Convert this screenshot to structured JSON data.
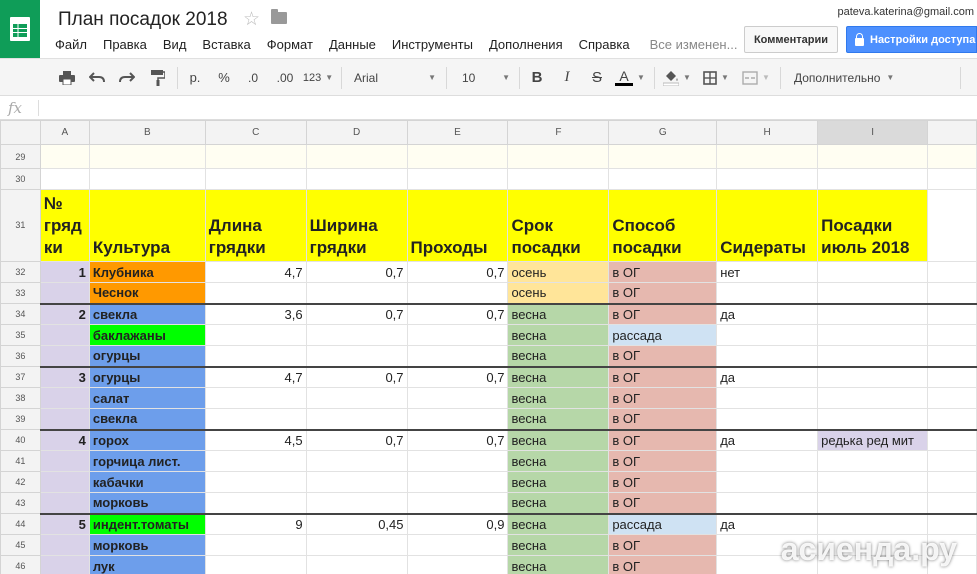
{
  "app": {
    "title": "План посадок 2018",
    "user_email": "pateva.katerina@gmail.com",
    "comments_label": "Комментарии",
    "share_label": "Настройки доступа",
    "save_status": "Все изменен..."
  },
  "menu": [
    "Файл",
    "Правка",
    "Вид",
    "Вставка",
    "Формат",
    "Данные",
    "Инструменты",
    "Дополнения",
    "Справка"
  ],
  "toolbar": {
    "currency": "р.",
    "percent": "%",
    "dec_less": ".0",
    "dec_more": ".00",
    "format_more": "123",
    "font": "Arial",
    "font_size": "10",
    "bold": "B",
    "italic": "I",
    "strike": "S",
    "text_color": "A",
    "more": "Дополнительно"
  },
  "formula_bar": {
    "fx": "fx",
    "value": ""
  },
  "columns": [
    "A",
    "B",
    "C",
    "D",
    "E",
    "F",
    "G",
    "H",
    "I"
  ],
  "header": {
    "row": "31",
    "A": "№ гряд ки",
    "B": "Культура",
    "C": "Длина грядки",
    "D": "Ширина грядки",
    "E": "Проходы",
    "F": "Срок посадки",
    "G": "Способ посадки",
    "H": "Сидераты",
    "I": "Посадки июль 2018"
  },
  "rows": [
    {
      "n": "29",
      "A": "",
      "B": "",
      "C": "",
      "D": "",
      "E": "",
      "F": "",
      "G": "",
      "H": "",
      "I": ""
    },
    {
      "n": "30",
      "A": "",
      "B": "",
      "C": "",
      "D": "",
      "E": "",
      "F": "",
      "G": "",
      "H": "",
      "I": ""
    },
    {
      "n": "32",
      "A": "1",
      "B": "Клубника",
      "C": "4,7",
      "D": "0,7",
      "E": "0,7",
      "F": "осень",
      "G": "в ОГ",
      "H": "нет",
      "I": ""
    },
    {
      "n": "33",
      "A": "",
      "B": "Чеснок",
      "C": "",
      "D": "",
      "E": "",
      "F": "осень",
      "G": "в ОГ",
      "H": "",
      "I": ""
    },
    {
      "n": "34",
      "A": "2",
      "B": "свекла",
      "C": "3,6",
      "D": "0,7",
      "E": "0,7",
      "F": "весна",
      "G": "в ОГ",
      "H": "да",
      "I": ""
    },
    {
      "n": "35",
      "A": "",
      "B": "баклажаны",
      "C": "",
      "D": "",
      "E": "",
      "F": "весна",
      "G": "рассада",
      "H": "",
      "I": ""
    },
    {
      "n": "36",
      "A": "",
      "B": "огурцы",
      "C": "",
      "D": "",
      "E": "",
      "F": "весна",
      "G": "в ОГ",
      "H": "",
      "I": ""
    },
    {
      "n": "37",
      "A": "3",
      "B": "огурцы",
      "C": "4,7",
      "D": "0,7",
      "E": "0,7",
      "F": "весна",
      "G": "в ОГ",
      "H": "да",
      "I": ""
    },
    {
      "n": "38",
      "A": "",
      "B": "салат",
      "C": "",
      "D": "",
      "E": "",
      "F": "весна",
      "G": "в ОГ",
      "H": "",
      "I": ""
    },
    {
      "n": "39",
      "A": "",
      "B": "свекла",
      "C": "",
      "D": "",
      "E": "",
      "F": "весна",
      "G": "в ОГ",
      "H": "",
      "I": ""
    },
    {
      "n": "40",
      "A": "4",
      "B": "горох",
      "C": "4,5",
      "D": "0,7",
      "E": "0,7",
      "F": "весна",
      "G": "в ОГ",
      "H": "да",
      "I": "редька ред мит"
    },
    {
      "n": "41",
      "A": "",
      "B": "горчица лист.",
      "C": "",
      "D": "",
      "E": "",
      "F": "весна",
      "G": "в ОГ",
      "H": "",
      "I": ""
    },
    {
      "n": "42",
      "A": "",
      "B": "кабачки",
      "C": "",
      "D": "",
      "E": "",
      "F": "весна",
      "G": "в ОГ",
      "H": "",
      "I": ""
    },
    {
      "n": "43",
      "A": "",
      "B": "морковь",
      "C": "",
      "D": "",
      "E": "",
      "F": "весна",
      "G": "в ОГ",
      "H": "",
      "I": ""
    },
    {
      "n": "44",
      "A": "5",
      "B": "индент.томаты",
      "C": "9",
      "D": "0,45",
      "E": "0,9",
      "F": "весна",
      "G": "рассада",
      "H": "да",
      "I": ""
    },
    {
      "n": "45",
      "A": "",
      "B": "морковь",
      "C": "",
      "D": "",
      "E": "",
      "F": "весна",
      "G": "в ОГ",
      "H": "",
      "I": ""
    },
    {
      "n": "46",
      "A": "",
      "B": "лук",
      "C": "",
      "D": "",
      "E": "",
      "F": "весна",
      "G": "в ОГ",
      "H": "",
      "I": ""
    }
  ],
  "colors": {
    "header_yellow": "#ffff00",
    "rownum_lavender": "#d9d2e9",
    "crop_orange": "#ff9900",
    "crop_blue": "#6d9eeb",
    "crop_green": "#00ff00",
    "autumn_tan": "#ffe599",
    "spring_green": "#b6d7a8",
    "og_pink": "#e6b8af",
    "seedling_blue": "#cfe2f3",
    "july_lavender": "#d9d2e9"
  },
  "watermark": "асиенда.ру"
}
